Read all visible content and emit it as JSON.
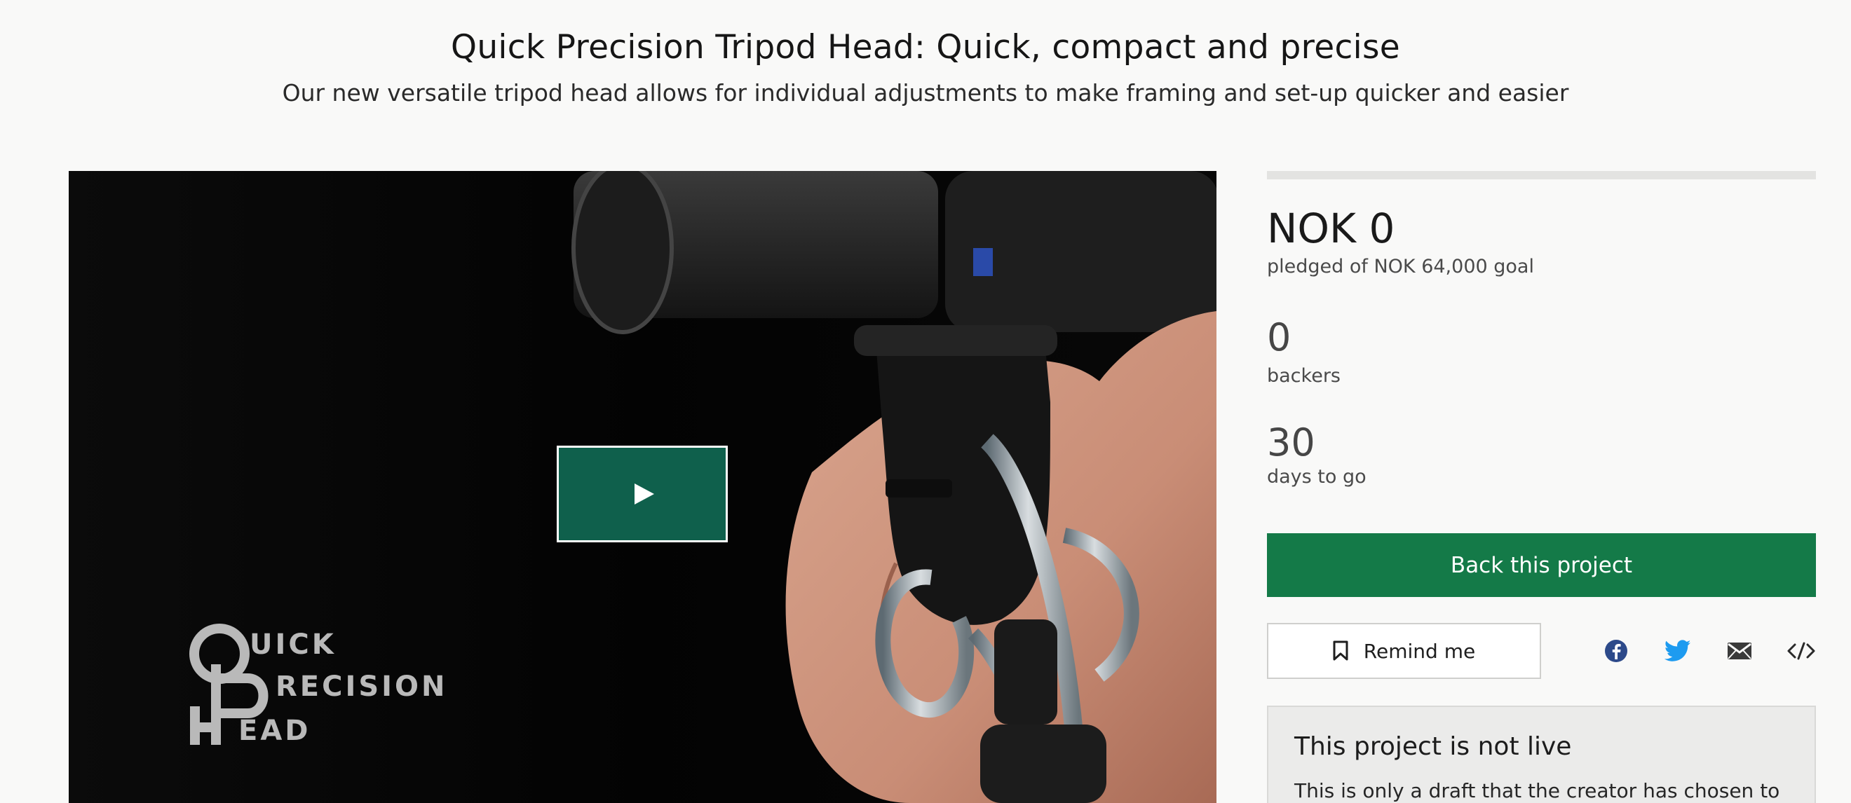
{
  "header": {
    "title": "Quick Precision Tripod Head: Quick, compact and precise",
    "subtitle": "Our new versatile tripod head allows for individual adjustments to make framing and set-up quicker and easier"
  },
  "video": {
    "play_icon": "play-icon",
    "logo_text": "QUICK PRECISION HEAD"
  },
  "stats": {
    "pledged": "NOK 0",
    "goal_text": "pledged of NOK 64,000 goal",
    "funded_fraction": 0,
    "backers_count": "0",
    "backers_label": "backers",
    "days_count": "30",
    "days_label": "days to go"
  },
  "actions": {
    "back_label": "Back this project",
    "remind_label": "Remind me",
    "remind_icon": "bookmark-icon",
    "share_icons": [
      "facebook-icon",
      "twitter-icon",
      "email-icon",
      "embed-icon"
    ]
  },
  "notice": {
    "title": "This project is not live",
    "text": "This is only a draft that the creator has chosen to"
  },
  "colors": {
    "accent_green": "#147a48",
    "play_green": "#0f604c",
    "facebook_blue": "#2d4a8a",
    "twitter_blue": "#1d9bf0"
  }
}
